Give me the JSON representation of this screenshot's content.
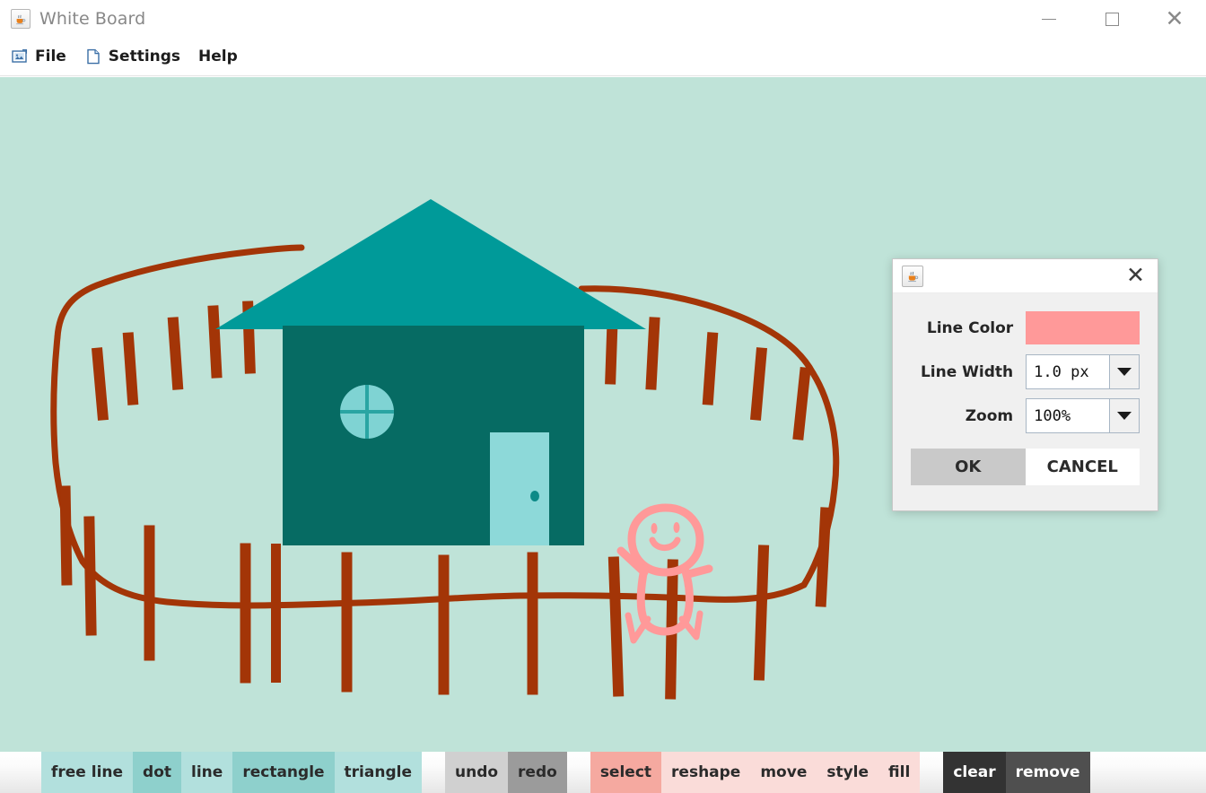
{
  "window": {
    "title": "White Board",
    "app_icon": "java-coffee-cup-icon",
    "minimize_label": "—",
    "maximize_label": "□",
    "close_label": "✕"
  },
  "menubar": {
    "items": [
      {
        "label": "File",
        "icon": "image-folder-icon"
      },
      {
        "label": "Settings",
        "icon": "document-page-icon"
      },
      {
        "label": "Help",
        "icon": ""
      }
    ]
  },
  "canvas": {
    "background_color": "#bfe3d8",
    "drawing_description": "house-with-fence-and-person",
    "colors": {
      "house_wall": "#066b63",
      "house_roof": "#009a99",
      "door": "#8dd9d9",
      "window": "#7fd3d3",
      "window_cross": "#2aa5a3",
      "fence": "#a33507",
      "person": "#ff9999"
    }
  },
  "toolbar": {
    "shape_tools": [
      {
        "label": "free line",
        "selected": false
      },
      {
        "label": "dot",
        "selected": true
      },
      {
        "label": "line",
        "selected": false
      },
      {
        "label": "rectangle",
        "selected": true
      },
      {
        "label": "triangle",
        "selected": false
      }
    ],
    "history_tools": [
      {
        "label": "undo",
        "selected": false
      },
      {
        "label": "redo",
        "selected": true
      }
    ],
    "edit_tools": [
      {
        "label": "select",
        "selected": true
      },
      {
        "label": "reshape",
        "selected": false
      },
      {
        "label": "move",
        "selected": false
      },
      {
        "label": "style",
        "selected": false
      },
      {
        "label": "fill",
        "selected": false
      }
    ],
    "destructive_tools": [
      {
        "label": "clear",
        "selected": true
      },
      {
        "label": "remove",
        "selected": false
      }
    ],
    "colors": {
      "shape_idle": "#b2e0dd",
      "shape_selected": "#8ed0cc",
      "history_idle": "#d0d0d0",
      "history_selected": "#9b9b9b",
      "edit_idle": "#fadcd9",
      "edit_selected": "#f5a9a0",
      "destructive_idle": "#4f4f4f",
      "destructive_selected": "#333333",
      "destructive_text": "#ffffff"
    }
  },
  "dialog": {
    "icon": "java-coffee-cup-icon",
    "close_label": "✕",
    "rows": [
      {
        "label": "Line Color",
        "type": "color",
        "value": "#ff9999"
      },
      {
        "label": "Line Width",
        "type": "combo",
        "value": "1.0  px"
      },
      {
        "label": "Zoom",
        "type": "combo",
        "value": "100%"
      }
    ],
    "ok_label": "OK",
    "cancel_label": "CANCEL",
    "ok_hovered": true
  }
}
